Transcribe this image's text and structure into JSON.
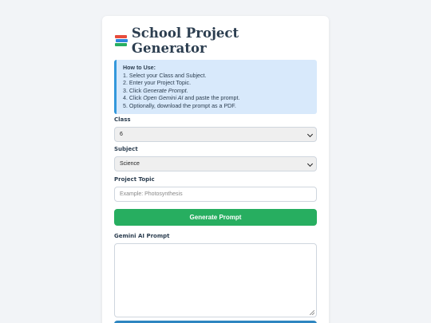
{
  "header": {
    "title": "School Project Generator",
    "icon": "books-icon"
  },
  "howto": {
    "title": "How to Use:",
    "steps": [
      {
        "text": "1. Select your Class and Subject."
      },
      {
        "text": "2. Enter your Project Topic."
      },
      {
        "pre": "3. Click ",
        "em": "Generate Prompt",
        "post": "."
      },
      {
        "pre": "4. Click ",
        "em": "Open Gemini AI",
        "post": " and paste the prompt."
      },
      {
        "text": "5. Optionally, download the prompt as a PDF."
      }
    ]
  },
  "form": {
    "class_label": "Class",
    "class_value": "6",
    "subject_label": "Subject",
    "subject_value": "Science",
    "topic_label": "Project Topic",
    "topic_placeholder": "Example: Photosynthesis",
    "generate_label": "Generate Prompt",
    "prompt_label": "Gemini AI Prompt"
  },
  "colors": {
    "accent_green": "#27ae60",
    "accent_blue": "#2e86c1",
    "info_bg": "#d8e9fb",
    "info_border": "#3498db"
  }
}
